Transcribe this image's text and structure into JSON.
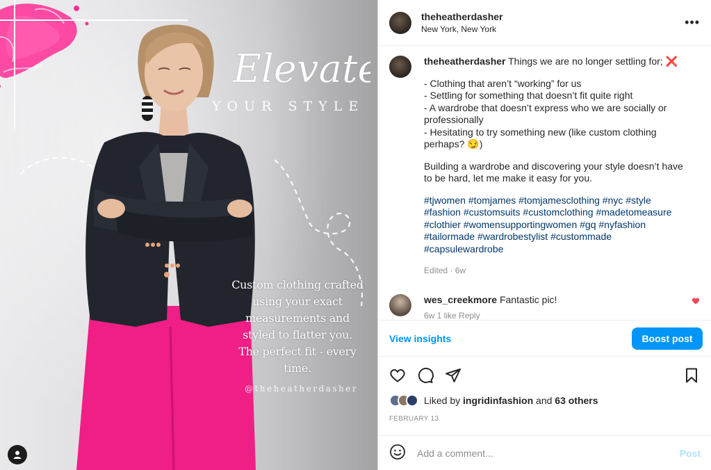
{
  "post_image": {
    "headline": "Elevate",
    "subheadline": "YOUR STYLE",
    "tagline_lines": [
      "Custom clothing crafted",
      "using your exact",
      "measurements and",
      "styled to flatter you.",
      "The perfect  fit - every",
      "time."
    ],
    "watermark": "@theheatherdasher",
    "colors": {
      "pink": "#ff2d95",
      "blazer": "#22252d",
      "pants": "#ef1f86"
    }
  },
  "header": {
    "username": "theheatherdasher",
    "location": "New York, New York",
    "more_icon": "more-horizontal-icon"
  },
  "caption": {
    "username": "theheatherdasher",
    "intro": "Things we are no longer settling for;",
    "emoji_x": "❌",
    "list": "- Clothing that aren’t “working” for us\n- Settling for something that doesn’t fit quite right\n- A wardrobe that doesn’t express who we are socially or professionally\n- Hesitating to try something new (like custom clothing perhaps? 😏)",
    "paragraph": "Building a wardrobe and discovering your style doesn’t have to be hard, let me make it easy for you.",
    "hashtags": "#tjwomen #tomjames #tomjamesclothing #nyc #style #fashion #customsuits #customclothing #madetomeasure #clothier #womensupportingwomen #gq #nyfashion #tailormade #wardrobestylist #custommade #capsulewardrobe",
    "meta": "Edited · 6w"
  },
  "comment": {
    "username": "wes_creekmore",
    "text": "Fantastic pic!",
    "sub": "6w    1 like    Reply"
  },
  "insights": {
    "view_label": "View insights",
    "boost_label": "Boost post"
  },
  "likes": {
    "prefix": "Liked by",
    "user": "ingridinfashion",
    "mid": "and",
    "others": "63 others"
  },
  "date": "FEBRUARY 13",
  "add_comment": {
    "placeholder": "Add a comment...",
    "post_label": "Post"
  },
  "accent_colors": {
    "link": "#00376b",
    "blue": "#0095f6",
    "heart": "#ed4956"
  }
}
